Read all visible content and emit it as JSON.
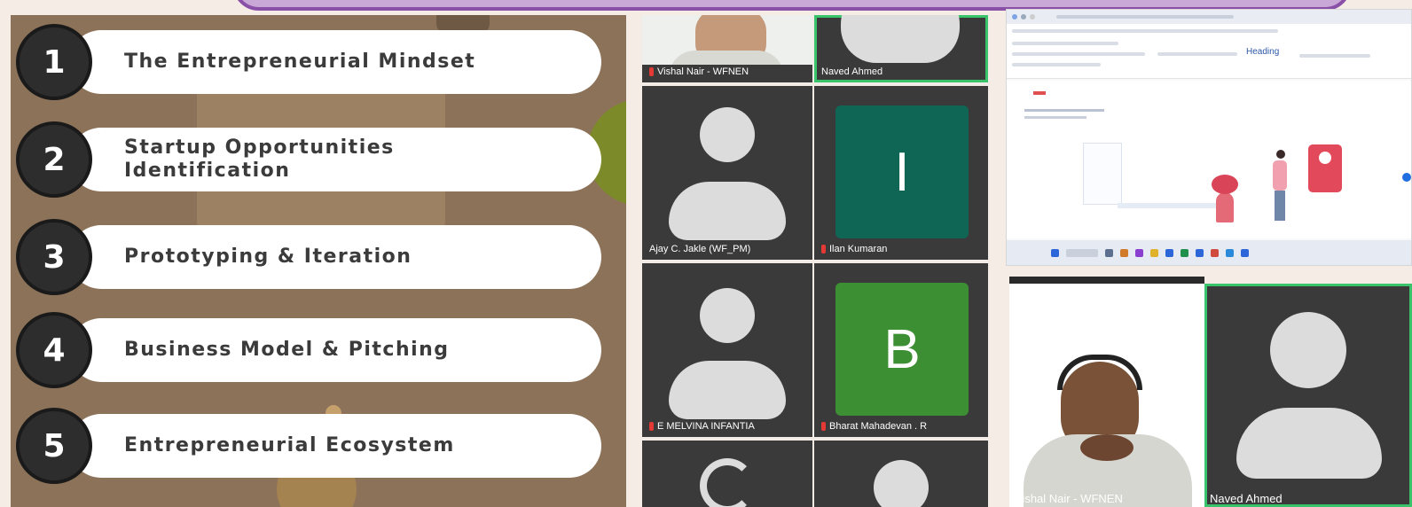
{
  "slide": {
    "topics": [
      {
        "number": "1",
        "title": "The Entrepreneurial Mindset"
      },
      {
        "number": "2",
        "title": "Startup Opportunities Identification"
      },
      {
        "number": "3",
        "title": "Prototyping & Iteration"
      },
      {
        "number": "4",
        "title": "Business Model & Pitching"
      },
      {
        "number": "5",
        "title": "Entrepreneurial Ecosystem"
      }
    ]
  },
  "video_grid": {
    "participants": [
      {
        "name": "Vishal Nair - WFNEN",
        "muted": true,
        "type": "video"
      },
      {
        "name": "Naved Ahmed",
        "muted": false,
        "type": "avatar",
        "active_speaker": true
      },
      {
        "name": "Ajay C. Jakle (WF_PM)",
        "muted": false,
        "type": "avatar"
      },
      {
        "name": "Ilan Kumaran",
        "muted": true,
        "type": "letter",
        "letter": "I",
        "color": "#0f6655"
      },
      {
        "name": "E MELVINA INFANTIA",
        "muted": true,
        "type": "avatar"
      },
      {
        "name": "Bharat Mahadevan . R",
        "muted": true,
        "type": "letter",
        "letter": "B",
        "color": "#3d8f34"
      }
    ]
  },
  "shared_screen": {
    "ribbon_style": "Heading"
  },
  "right_tiles": [
    {
      "name": "Vishal Nair - WFNEN",
      "type": "video"
    },
    {
      "name": "Naved Ahmed",
      "type": "avatar",
      "active_speaker": true
    }
  ],
  "colors": {
    "slide_bg": "#8b7258",
    "banner": "#c9a8d8",
    "active_speaker": "#39c46b",
    "mic_muted": "#e53935"
  }
}
